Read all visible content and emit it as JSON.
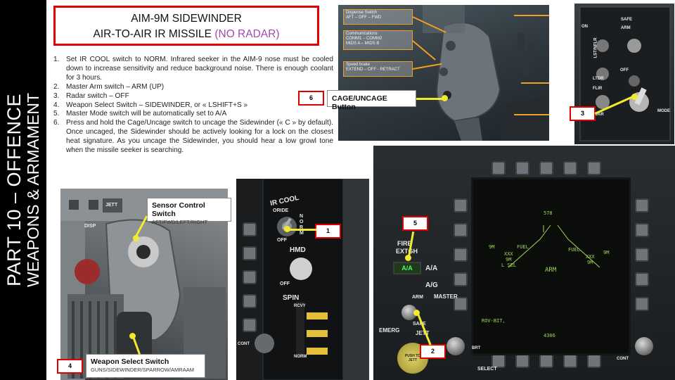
{
  "banner": {
    "line1": "PART 10 – OFFENCE",
    "line2": "WEAPONS & ARMAMENT"
  },
  "title": {
    "line1": "AIM-9M SIDEWINDER",
    "line2_main": "AIR-TO-AIR IR MISSILE",
    "line2_note": "(NO RADAR)"
  },
  "steps": [
    {
      "num": "1.",
      "text": "Set IR COOL switch to NORM. Infrared seeker in the AIM-9 nose must be cooled down to increase sensitivity and reduce background noise. There is enough coolant for 3 hours."
    },
    {
      "num": "2.",
      "text": "Master Arm switch – ARM (UP)"
    },
    {
      "num": "3.",
      "text": "Radar switch – OFF"
    },
    {
      "num": "4.",
      "text": "Weapon Select Switch – SIDEWINDER, or « LSHIFT+S »"
    },
    {
      "num": "5.",
      "text": "Master Mode switch will be automatically set to A/A"
    },
    {
      "num": "6.",
      "text": "Press and hold the Cage/Uncage switch to uncage the Sidewinder (« C » by default). Once uncaged, the Sidewinder should be actively looking for a lock on the closest heat signature. As you uncage the Sidewinder, you should hear a low growl tone when the missile seeker is searching."
    }
  ],
  "throttle": {
    "labels": [
      "Dispense Switch",
      "AFT – OFF – FWD",
      "Communications",
      "COMM1 – COMM2",
      "MIDS A – MIDS B",
      "Speed brake",
      "EXTEND – OFF - RETRACT"
    ],
    "cage_callout": "CAGE/UNCAGE Button",
    "cage_num": "6"
  },
  "radar_panel": {
    "num": "3",
    "labels": [
      "LST/NFLR",
      "LTDR",
      "FLIR",
      "RADAR",
      "OFF",
      "ON",
      "SAFE",
      "ARM",
      "MODE"
    ]
  },
  "stick": {
    "sensor_title": "Sensor Control Switch",
    "sensor_sub": "AFT/FWD/LEFT/RIGHT",
    "weapon_title": "Weapon Select Switch",
    "weapon_sub": "GUNS/SIDEWINDER/SPARROW/AMRAAM",
    "num": "4",
    "labels": [
      "JETT",
      "DISP"
    ]
  },
  "ircool": {
    "title": "IR COOL",
    "oride": "ORIDE",
    "norm": "N O R M",
    "off": "OFF",
    "hmd": "HMD",
    "hmd_off": "OFF",
    "spin": "SPIN",
    "rcvy": "RCVY",
    "norm2": "NORM",
    "cont": "CONT",
    "num": "1"
  },
  "mfd": {
    "fire_l1": "FIRE",
    "fire_l2": "EXTGH",
    "aa": "A/A",
    "ag": "A/G",
    "master_vertical": "MASTER",
    "arm": "ARM",
    "safe": "SAFE",
    "emerg": "EMERG",
    "jett": "JETT",
    "push": "PUSH TO JETT",
    "brt": "BRT",
    "cont": "CONT",
    "select": "SELECT",
    "num5": "5",
    "num2": "2",
    "screen": {
      "top": "578",
      "sw_l": "9M",
      "fuel_l": "FUEL",
      "xx_l": "XXX",
      "nine_l": "9M",
      "lsel": "L SEL",
      "fuel_r": "FUEL",
      "sw_r": "9M",
      "xx_r": "XXX",
      "nine_r": "9M",
      "arm": "ARM",
      "bit": "ROV-BIT,",
      "bottom": "4306"
    }
  },
  "colors": {
    "red": "#e10000",
    "orange": "#f0a020",
    "yellow_arrow": "#f2ea30",
    "purple_note": "#a24aa8",
    "mfd_green": "#9fd65a"
  }
}
